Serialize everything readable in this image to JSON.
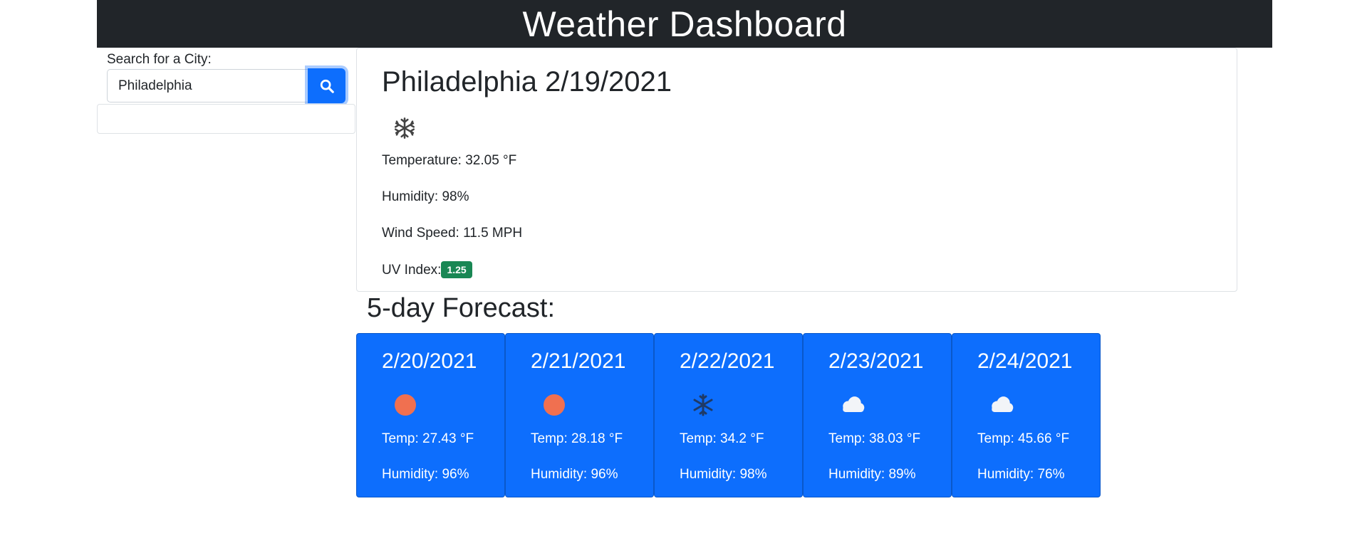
{
  "header": {
    "title": "Weather Dashboard"
  },
  "search": {
    "label": "Search for a City:",
    "value": "Philadelphia",
    "button_icon": "search-icon"
  },
  "current": {
    "title": "Philadelphia 2/19/2021",
    "icon": "snowflake-icon",
    "temperature": "Temperature: 32.05 °F",
    "humidity": "Humidity: 98%",
    "wind": "Wind Speed: 11.5 MPH",
    "uv_label": "UV Index:",
    "uv_value": "1.25",
    "uv_color": "#198754"
  },
  "forecast": {
    "heading": "5-day Forecast:",
    "days": [
      {
        "date": "2/20/2021",
        "icon": "sun-icon",
        "temp": "Temp: 27.43 °F",
        "humidity": "Humidity: 96%"
      },
      {
        "date": "2/21/2021",
        "icon": "sun-icon",
        "temp": "Temp: 28.18 °F",
        "humidity": "Humidity: 96%"
      },
      {
        "date": "2/22/2021",
        "icon": "snowflake-icon",
        "temp": "Temp: 34.2 °F",
        "humidity": "Humidity: 98%"
      },
      {
        "date": "2/23/2021",
        "icon": "cloud-icon",
        "temp": "Temp: 38.03 °F",
        "humidity": "Humidity: 89%"
      },
      {
        "date": "2/24/2021",
        "icon": "cloud-icon",
        "temp": "Temp: 45.66 °F",
        "humidity": "Humidity: 76%"
      }
    ]
  },
  "colors": {
    "header_bg": "#212529",
    "primary": "#0d6efd",
    "sun": "#f07050"
  }
}
